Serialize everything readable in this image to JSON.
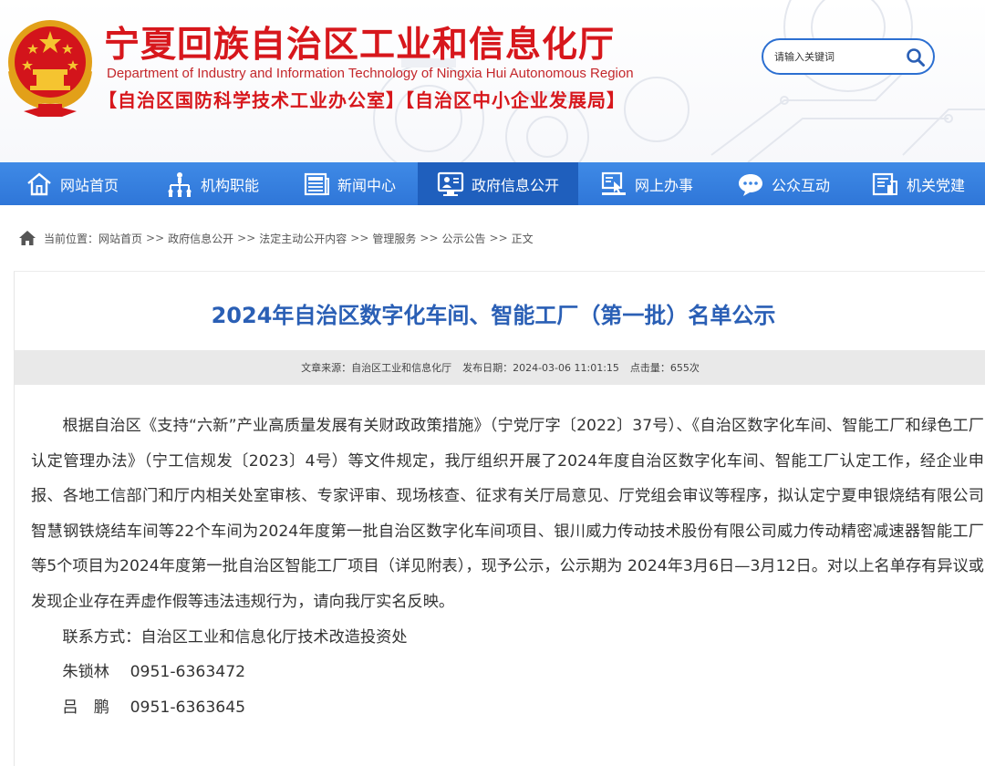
{
  "header": {
    "title": "宁夏回族自治区工业和信息化厅",
    "subtitle_en": "Department of Industry and Information Technology of Ningxia Hui Autonomous Region",
    "subtitle_cn": "【自治区国防科学技术工业办公室】【自治区中小企业发展局】"
  },
  "search": {
    "placeholder": "请输入关键词"
  },
  "nav": {
    "items": [
      {
        "label": "网站首页",
        "icon": "home-icon"
      },
      {
        "label": "机构职能",
        "icon": "org-chart-icon"
      },
      {
        "label": "新闻中心",
        "icon": "newspaper-icon"
      },
      {
        "label": "政府信息公开",
        "icon": "monitor-user-icon",
        "active": true
      },
      {
        "label": "网上办事",
        "icon": "online-service-icon"
      },
      {
        "label": "公众互动",
        "icon": "chat-bubble-icon"
      },
      {
        "label": "机关党建",
        "icon": "party-building-icon"
      }
    ]
  },
  "breadcrumb": {
    "prefix": "当前位置：",
    "items": [
      "网站首页",
      "政府信息公开",
      "法定主动公开内容",
      "管理服务",
      "公示公告",
      "正文"
    ],
    "separator": ">>"
  },
  "article": {
    "title": "2024年自治区数字化车间、智能工厂（第一批）名单公示",
    "meta": {
      "source": "文章来源：自治区工业和信息化厅",
      "date": "发布日期：2024-03-06 11:01:15",
      "hits": "点击量：655次"
    },
    "body": "根据自治区《支持“六新”产业高质量发展有关财政政策措施》（宁党厅字〔2022〕37号）、《自治区数字化车间、智能工厂和绿色工厂认定管理办法》（宁工信规发〔2023〕4号）等文件规定，我厅组织开展了2024年度自治区数字化车间、智能工厂认定工作，经企业申报、各地工信部门和厅内相关处室审核、专家评审、现场核查、征求有关厅局意见、厅党组会审议等程序，拟认定宁夏申银烧结有限公司智慧钢铁烧结车间等22个车间为2024年度第一批自治区数字化车间项目、银川威力传动技术股份有限公司威力传动精密减速器智能工厂等5个项目为2024年度第一批自治区智能工厂项目（详见附表），现予公示，公示期为 2024年3月6日—3月12日。对以上名单存有异议或发现企业存在弄虚作假等违法违规行为，请向我厅实名反映。",
    "contact_label": "联系方式：自治区工业和信息化厅技术改造投资处",
    "contacts": [
      "朱锁林　 0951-6363472",
      "吕　鹏　 0951-6363645"
    ]
  }
}
